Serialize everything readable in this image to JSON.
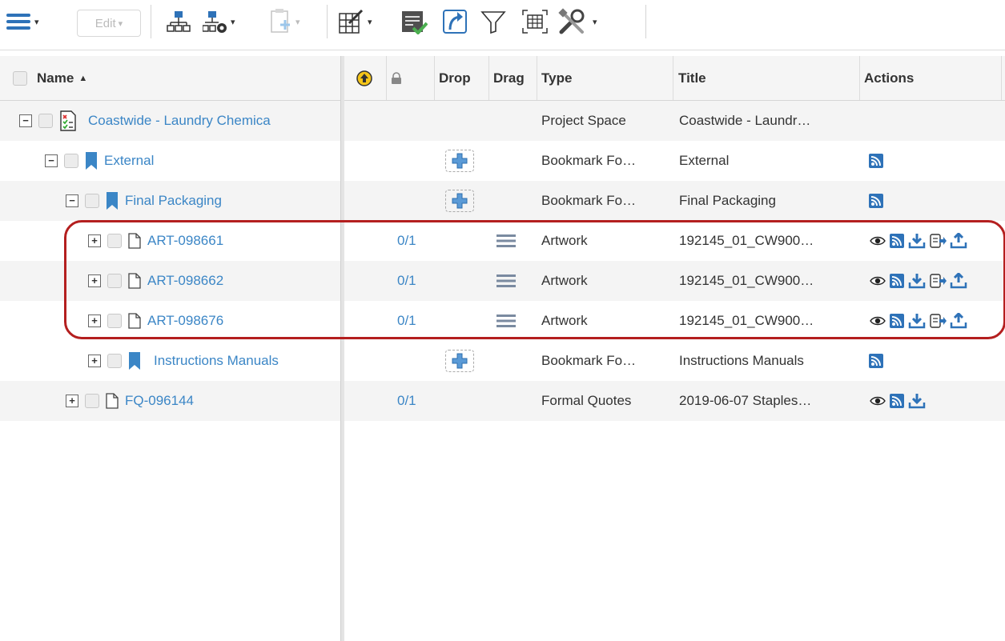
{
  "toolbar": {
    "edit_label": "Edit"
  },
  "columns": {
    "name": "Name",
    "drop": "Drop",
    "drag": "Drag",
    "type": "Type",
    "title": "Title",
    "actions": "Actions"
  },
  "rows": [
    {
      "name": "Coastwide - Laundry Chemica",
      "type": "Project Space",
      "title": "Coastwide - Laundr…"
    },
    {
      "name": "External",
      "type": "Bookmark Fo…",
      "title": "External"
    },
    {
      "name": "Final Packaging",
      "type": "Bookmark Fo…",
      "title": "Final Packaging"
    },
    {
      "name": "ART-098661",
      "state": "0/1",
      "type": "Artwork",
      "title": "192145_01_CW900…"
    },
    {
      "name": "ART-098662",
      "state": "0/1",
      "type": "Artwork",
      "title": "192145_01_CW900…"
    },
    {
      "name": "ART-098676",
      "state": "0/1",
      "type": "Artwork",
      "title": "192145_01_CW900…"
    },
    {
      "name": "Instructions Manuals",
      "type": "Bookmark Fo…",
      "title": "Instructions Manuals"
    },
    {
      "name": "FQ-096144",
      "state": "0/1",
      "type": "Formal Quotes",
      "title": "2019-06-07 Staples…"
    }
  ],
  "icons": {
    "menu": "hamburger-menu-icon",
    "structure": "structure-tree-icon",
    "structure_config": "structure-config-icon",
    "add": "add-document-icon",
    "edit_table": "edit-table-icon",
    "approve": "approve-list-icon",
    "open": "open-arrow-icon",
    "filter": "filter-icon",
    "grid": "grid-layout-icon",
    "tools": "tools-icon"
  },
  "colors": {
    "link": "#3b86c6",
    "highlight": "#b41f1f",
    "accent_blue": "#2e72b8"
  }
}
